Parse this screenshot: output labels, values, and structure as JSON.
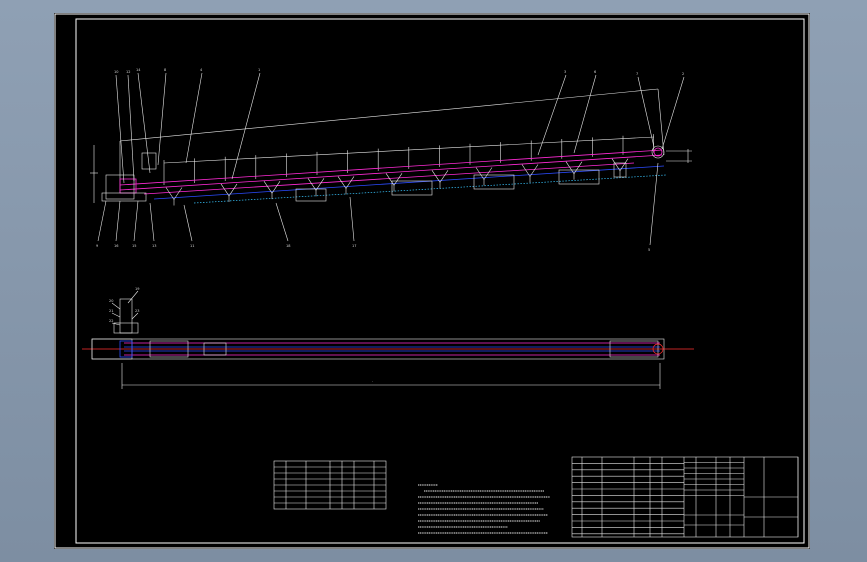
{
  "side_view": {
    "leader_labels_top": [
      "10",
      "12",
      "14",
      "8",
      "4",
      "1",
      "3",
      "6",
      "7",
      "2"
    ],
    "leader_labels_bottom": [
      "9",
      "16",
      "15",
      "13",
      "11",
      "18",
      "17",
      "5"
    ]
  },
  "plan_view": {
    "leader_labels": [
      "19",
      "20",
      "21",
      "22",
      "23"
    ]
  },
  "colors": {
    "background": "#000000",
    "frame": "#ffffff",
    "conveyor_belt": "#ff2bd6",
    "structure": "#2b4bff",
    "centerline": "#39c6ff",
    "axis": "#ff3030"
  }
}
